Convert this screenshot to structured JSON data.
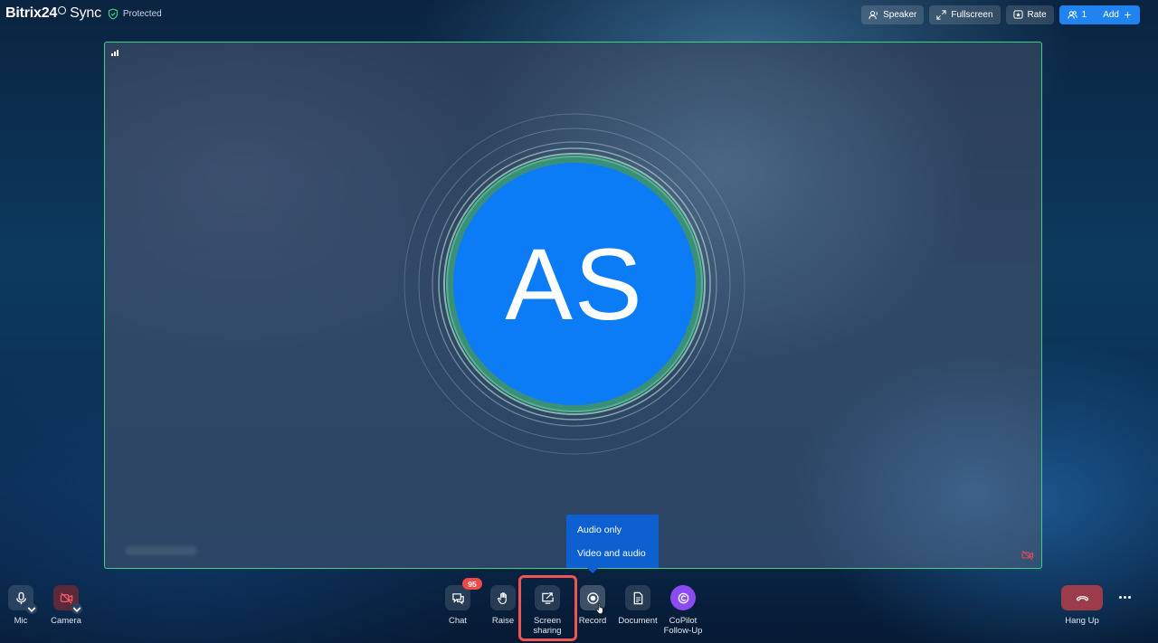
{
  "app": {
    "brand_name": "Bitrix24",
    "brand_product": "Sync",
    "security_status": "Protected"
  },
  "top_actions": {
    "speaker": "Speaker",
    "fullscreen": "Fullscreen",
    "rate": "Rate",
    "participants_count": "1",
    "add": "Add"
  },
  "participant": {
    "initials": "AS",
    "avatar_color": "#0b7cf5",
    "speaking_border_color": "#3ad37f"
  },
  "record_menu": {
    "options": [
      "Audio only",
      "Video and audio"
    ]
  },
  "controls": {
    "mic": "Mic",
    "camera": "Camera",
    "chat": "Chat",
    "chat_badge": "95",
    "raise": "Raise",
    "screen_sharing_line1": "Screen",
    "screen_sharing_line2": "sharing",
    "record": "Record",
    "document": "Document",
    "copilot_line1": "CoPilot",
    "copilot_line2": "Follow-Up",
    "hang_up": "Hang Up"
  }
}
